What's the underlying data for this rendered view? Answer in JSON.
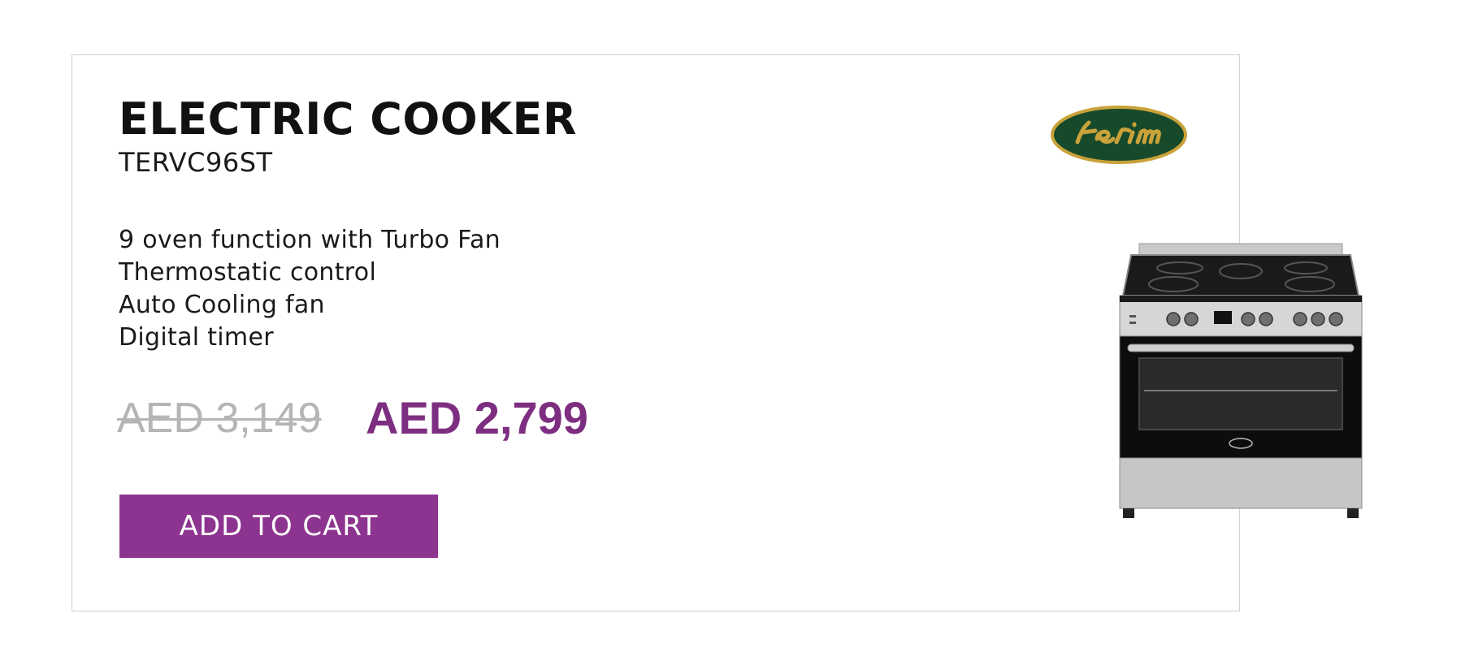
{
  "product": {
    "title": "ELECTRIC COOKER",
    "model": "TERVC96ST",
    "features": [
      "9 oven function with Turbo Fan",
      "Thermostatic control",
      "Auto Cooling fan",
      "Digital timer"
    ]
  },
  "pricing": {
    "old_price": "AED 3,149",
    "new_price": "AED 2,799"
  },
  "actions": {
    "add_to_cart_label": "ADD TO CART"
  },
  "brand": {
    "logo_text": "terim",
    "icon": "brand-logo",
    "colors": {
      "logo_fill": "#174a2b",
      "logo_text": "#c9a23a"
    }
  },
  "colors": {
    "accent": "#8d3490",
    "new_price": "#7d2e80",
    "old_price": "#b5b5b5",
    "card_border": "#cfcfcf"
  }
}
